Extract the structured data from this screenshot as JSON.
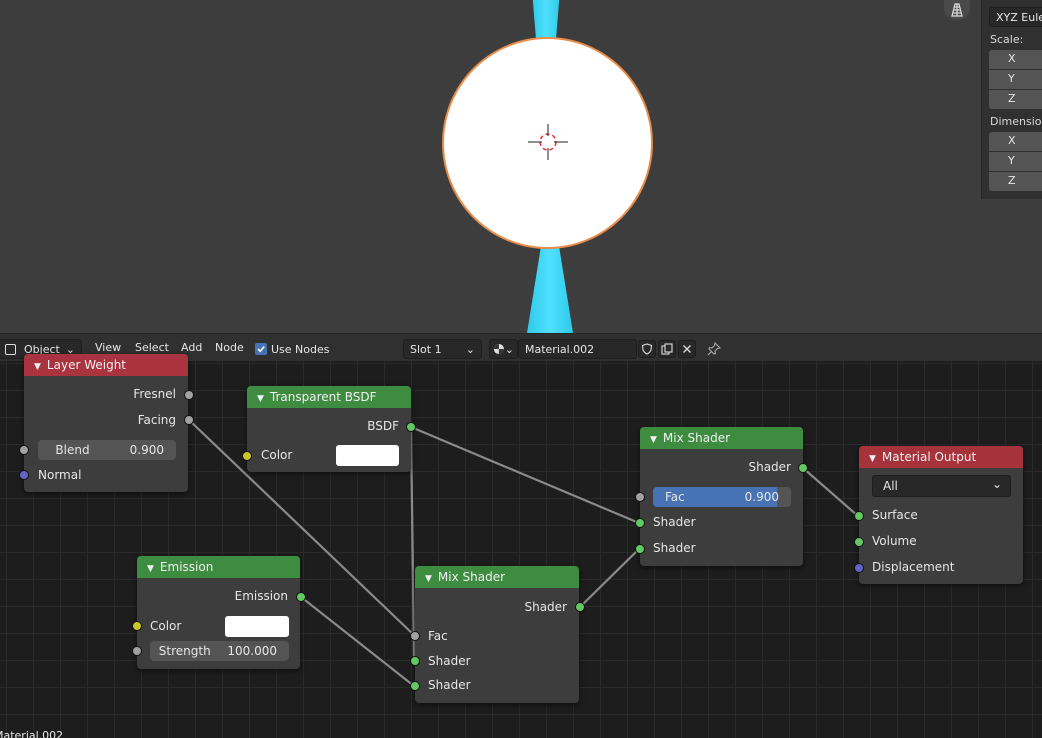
{
  "viewport": {
    "transform_panel": {
      "rotation_mode": "XYZ Euler",
      "scale_label": "Scale:",
      "scale_axes": [
        "X",
        "Y",
        "Z"
      ],
      "dimensions_label": "Dimensions",
      "dimensions_axes": [
        "X",
        "Y",
        "Z"
      ]
    },
    "icons": [
      "grid-view-icon",
      "3d-cursor-icon"
    ]
  },
  "node_header": {
    "mode": "Object",
    "menus": [
      "View",
      "Select",
      "Add",
      "Node"
    ],
    "use_nodes_label": "Use Nodes",
    "use_nodes_checked": true,
    "slot": "Slot 1",
    "material_name": "Material.002"
  },
  "status_text": "Material.002",
  "nodes": {
    "layer_weight": {
      "title": "Layer Weight",
      "outputs": [
        "Fresnel",
        "Facing"
      ],
      "blend_label": "Blend",
      "blend_value": "0.900",
      "inputs": [
        "Normal"
      ]
    },
    "transparent_bsdf": {
      "title": "Transparent BSDF",
      "output": "BSDF",
      "color_label": "Color",
      "color_value": "#ffffff"
    },
    "emission": {
      "title": "Emission",
      "output": "Emission",
      "color_label": "Color",
      "color_value": "#ffffff",
      "strength_label": "Strength",
      "strength_value": "100.000"
    },
    "mix_shader_1": {
      "title": "Mix Shader",
      "output": "Shader",
      "inputs": [
        "Fac",
        "Shader",
        "Shader"
      ]
    },
    "mix_shader_2": {
      "title": "Mix Shader",
      "output": "Shader",
      "fac_label": "Fac",
      "fac_value": "0.900",
      "fac_fraction": 0.9,
      "inputs": [
        "Shader",
        "Shader"
      ]
    },
    "material_output": {
      "title": "Material Output",
      "target": "All",
      "inputs": [
        "Surface",
        "Volume",
        "Displacement"
      ]
    }
  },
  "colors": {
    "shader_socket": "#63c763",
    "float_socket": "#a1a1a1",
    "color_socket": "#c7c729",
    "vector_socket": "#6363c7",
    "input_node_header": "#a9333e",
    "shader_node_header": "#3d8c40",
    "output_node_header": "#a6333b",
    "selection_outline": "#e88c4a",
    "beam": "#4fe0ff"
  }
}
